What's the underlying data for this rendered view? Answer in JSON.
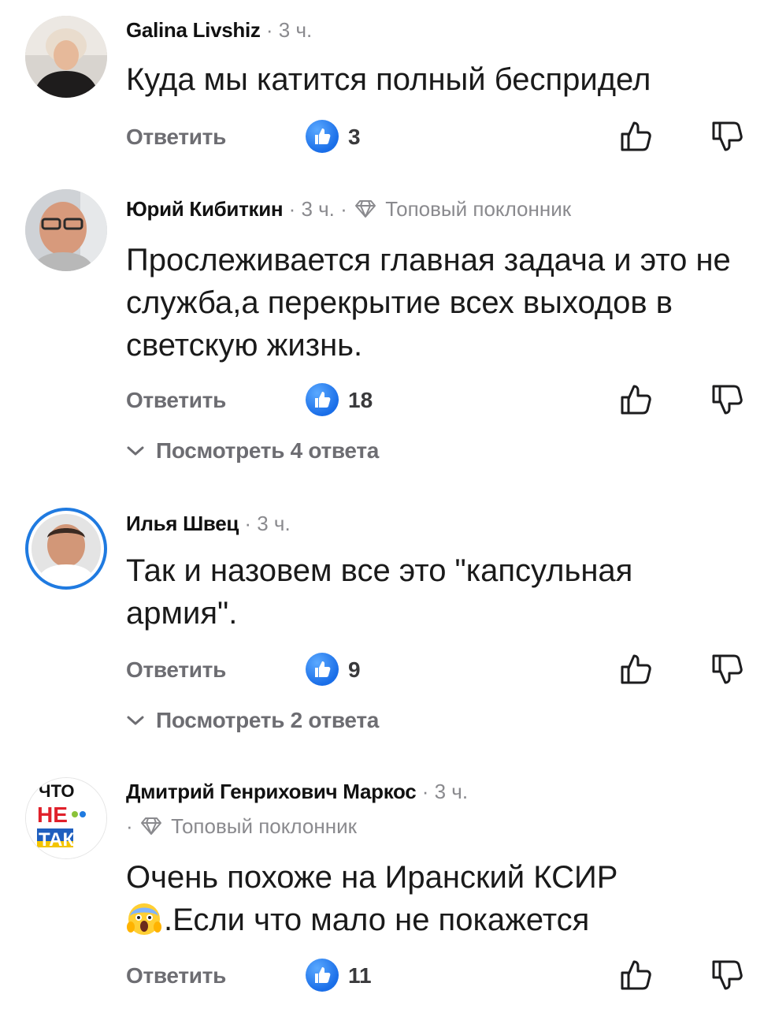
{
  "comments": [
    {
      "author": "Galina Livshiz",
      "time": "3 ч.",
      "badge": "",
      "text": "Куда мы катится полный беспридел",
      "reply_label": "Ответить",
      "likes": "3",
      "view_replies": ""
    },
    {
      "author": "Юрий Кибиткин",
      "time": "3 ч.",
      "badge": "Топовый поклонник",
      "text": "Прослеживается главная задача и это не служба,а перекрытие всех выходов в светскую жизнь.",
      "reply_label": "Ответить",
      "likes": "18",
      "view_replies": "Посмотреть 4 ответа"
    },
    {
      "author": "Илья Швец",
      "time": "3 ч.",
      "badge": "",
      "text": "Так и назовем все это \"капсульная армия\".",
      "reply_label": "Ответить",
      "likes": "9",
      "view_replies": "Посмотреть 2 ответа"
    },
    {
      "author": "Дмитрий Генрихович Маркос",
      "time": "3 ч.",
      "badge": "Топовый поклонник",
      "text_line1": "Очень похоже на Иранский КСИР",
      "text_line2": ".Если что мало не покажется",
      "reply_label": "Ответить",
      "likes": "11",
      "view_replies": ""
    }
  ],
  "avatar4_logo": [
    "ЧТО",
    "НЕ",
    "ТАК"
  ],
  "icons": {
    "like_badge": "like-badge-icon",
    "thumb_up": "thumb-up-icon",
    "thumb_down": "thumb-down-icon",
    "diamond": "diamond-icon",
    "chevron": "chevron-down-icon",
    "emoji": "screaming-face-emoji"
  },
  "colors": {
    "accent": "#1a6ee8",
    "muted": "#6d6d72"
  }
}
